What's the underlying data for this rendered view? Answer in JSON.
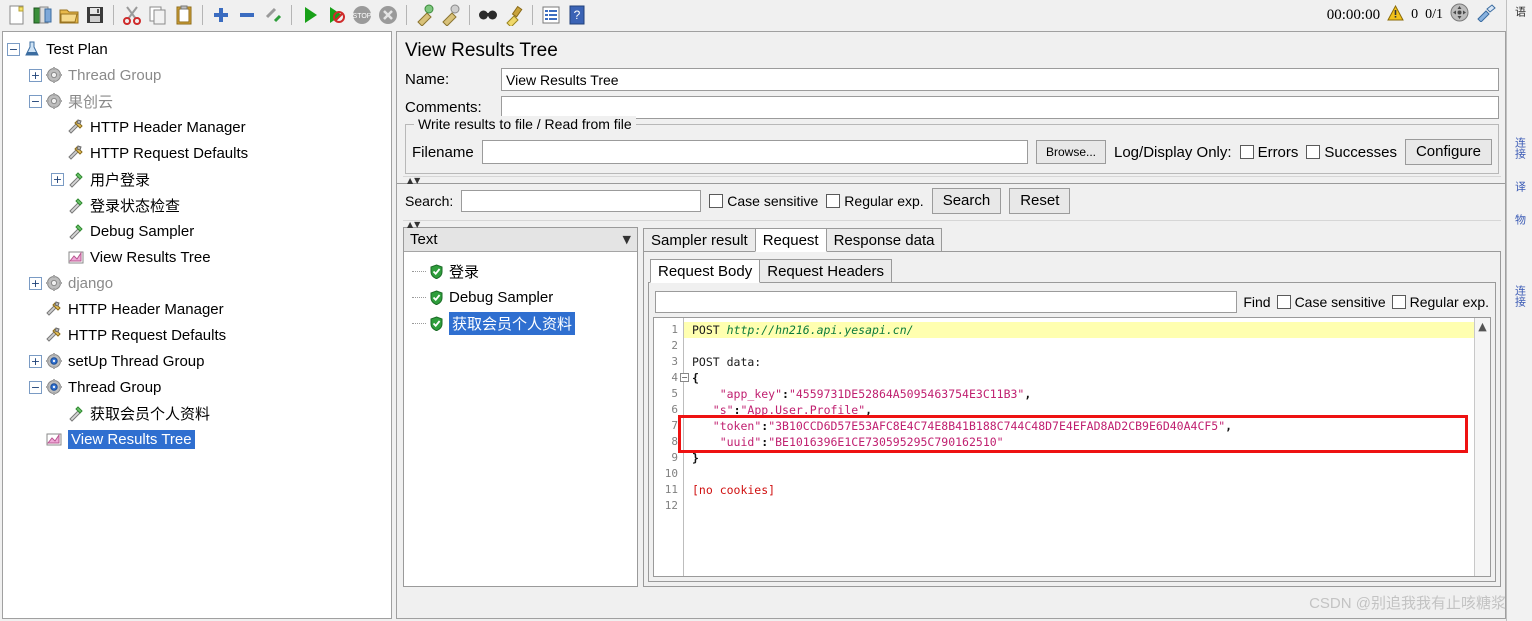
{
  "toolbar": {
    "buttons": [
      {
        "name": "new-icon",
        "glyph": "Ὄ4",
        "title": "New"
      },
      {
        "name": "templates-icon",
        "title": "Templates"
      },
      {
        "name": "open-icon",
        "title": "Open"
      },
      {
        "name": "save-icon",
        "title": "Save"
      },
      {
        "name": "cut-icon",
        "title": "Cut"
      },
      {
        "name": "copy-icon",
        "title": "Copy"
      },
      {
        "name": "paste-icon",
        "title": "Paste"
      },
      {
        "name": "expand-all-icon",
        "title": "Expand All"
      },
      {
        "name": "collapse-all-icon",
        "title": "Collapse All"
      },
      {
        "name": "toggle-icon",
        "title": "Toggle"
      },
      {
        "name": "start-icon",
        "title": "Start"
      },
      {
        "name": "start-no-pauses-icon",
        "title": "Start no pauses"
      },
      {
        "name": "stop-icon",
        "title": "Stop"
      },
      {
        "name": "shutdown-icon",
        "title": "Shutdown"
      },
      {
        "name": "clear-icon",
        "title": "Clear"
      },
      {
        "name": "clear-all-icon",
        "title": "Clear All"
      },
      {
        "name": "search-icon",
        "title": "Search"
      },
      {
        "name": "reset-search-icon",
        "title": "Reset Search"
      },
      {
        "name": "function-helper-icon",
        "title": "Function Helper Dialog"
      },
      {
        "name": "help-icon",
        "title": "Help"
      }
    ]
  },
  "status": {
    "elapsed": "00:00:00",
    "warning_count": "0",
    "threads": "0/1"
  },
  "tree": {
    "nodes": [
      {
        "label": "Test Plan",
        "indent": 0,
        "toggle": "minus",
        "icon": "test-plan-icon",
        "dim": false,
        "selected": false
      },
      {
        "label": "Thread Group",
        "indent": 1,
        "toggle": "plus",
        "icon": "thread-group-icon",
        "dim": true,
        "selected": false
      },
      {
        "label": "果创云",
        "indent": 1,
        "toggle": "minus",
        "icon": "thread-group-icon",
        "dim": true,
        "selected": false
      },
      {
        "label": "HTTP Header Manager",
        "indent": 2,
        "toggle": "none",
        "icon": "config-icon",
        "dim": false,
        "selected": false
      },
      {
        "label": "HTTP Request Defaults",
        "indent": 2,
        "toggle": "none",
        "icon": "config-icon",
        "dim": false,
        "selected": false
      },
      {
        "label": "用户登录",
        "indent": 2,
        "toggle": "plus",
        "icon": "sampler-icon",
        "dim": false,
        "selected": false
      },
      {
        "label": "登录状态检查",
        "indent": 2,
        "toggle": "none",
        "icon": "sampler-icon",
        "dim": false,
        "selected": false
      },
      {
        "label": "Debug Sampler",
        "indent": 2,
        "toggle": "none",
        "icon": "sampler-icon",
        "dim": false,
        "selected": false
      },
      {
        "label": "View Results Tree",
        "indent": 2,
        "toggle": "none",
        "icon": "listener-icon",
        "dim": false,
        "selected": false
      },
      {
        "label": "django",
        "indent": 1,
        "toggle": "plus",
        "icon": "thread-group-icon",
        "dim": true,
        "selected": false
      },
      {
        "label": "HTTP Header Manager",
        "indent": 1,
        "toggle": "none",
        "icon": "config-icon",
        "dim": false,
        "selected": false
      },
      {
        "label": "HTTP Request Defaults",
        "indent": 1,
        "toggle": "none",
        "icon": "config-icon",
        "dim": false,
        "selected": false
      },
      {
        "label": "setUp Thread Group",
        "indent": 1,
        "toggle": "plus",
        "icon": "setup-thread-group-icon",
        "dim": false,
        "selected": false
      },
      {
        "label": "Thread Group",
        "indent": 1,
        "toggle": "minus",
        "icon": "setup-thread-group-icon",
        "dim": false,
        "selected": false
      },
      {
        "label": "获取会员个人资料",
        "indent": 2,
        "toggle": "none",
        "icon": "sampler-icon",
        "dim": false,
        "selected": false
      },
      {
        "label": "View Results Tree",
        "indent": 1,
        "toggle": "none",
        "icon": "listener-icon",
        "dim": false,
        "selected": true
      }
    ]
  },
  "panel": {
    "title": "View Results Tree",
    "name_label": "Name:",
    "name_value": "View Results Tree",
    "comments_label": "Comments:",
    "comments_value": "",
    "comments_placeholder": "",
    "file_group_title": "Write results to file / Read from file",
    "filename_label": "Filename",
    "filename_value": "",
    "browse_label": "Browse...",
    "log_display_label": "Log/Display Only:",
    "errors_label": "Errors",
    "successes_label": "Successes",
    "configure_label": "Configure"
  },
  "search": {
    "label": "Search:",
    "value": "",
    "case_sensitive_label": "Case sensitive",
    "regular_exp_label": "Regular exp.",
    "search_button": "Search",
    "reset_button": "Reset"
  },
  "results": {
    "renderer_selected": "Text",
    "items": [
      {
        "label": "登录",
        "status": "success",
        "selected": false
      },
      {
        "label": "Debug Sampler",
        "status": "success",
        "selected": false
      },
      {
        "label": "获取会员个人资料",
        "status": "success",
        "selected": true
      }
    ]
  },
  "detail": {
    "tabs": [
      {
        "label": "Sampler result",
        "active": false
      },
      {
        "label": "Request",
        "active": true
      },
      {
        "label": "Response data",
        "active": false
      }
    ],
    "subtabs": [
      {
        "label": "Request Body",
        "active": true
      },
      {
        "label": "Request Headers",
        "active": false
      }
    ],
    "find": {
      "value": "",
      "find_label": "Find",
      "case_sensitive_label": "Case sensitive",
      "regular_exp_label": "Regular exp."
    },
    "code": {
      "line_numbers": [
        "1",
        "2",
        "3",
        "4",
        "5",
        "6",
        "7",
        "8",
        "9",
        "10",
        "11",
        "12"
      ],
      "lines": [
        {
          "n": 1,
          "highlight": true,
          "segments": [
            {
              "t": "POST ",
              "c": "kw-post"
            },
            {
              "t": "http://hn216.api.yesapi.cn/",
              "c": "url"
            }
          ]
        },
        {
          "n": 2,
          "highlight": false,
          "segments": []
        },
        {
          "n": 3,
          "highlight": false,
          "segments": [
            {
              "t": "POST data:",
              "c": "kw-post"
            }
          ]
        },
        {
          "n": 4,
          "highlight": false,
          "fold": true,
          "segments": [
            {
              "t": "{",
              "c": "punc"
            }
          ]
        },
        {
          "n": 5,
          "highlight": false,
          "segments": [
            {
              "t": "    ",
              "c": ""
            },
            {
              "t": "\"app_key\"",
              "c": "jkey"
            },
            {
              "t": ":",
              "c": "punc"
            },
            {
              "t": "\"4559731DE52864A5095463754E3C11B3\"",
              "c": "jstr"
            },
            {
              "t": ",",
              "c": "punc"
            }
          ]
        },
        {
          "n": 6,
          "highlight": false,
          "segments": [
            {
              "t": "   ",
              "c": ""
            },
            {
              "t": "\"s\"",
              "c": "jkey"
            },
            {
              "t": ":",
              "c": "punc"
            },
            {
              "t": "\"App.User.Profile\"",
              "c": "jstr"
            },
            {
              "t": ",",
              "c": "punc"
            }
          ]
        },
        {
          "n": 7,
          "highlight": false,
          "segments": [
            {
              "t": "   ",
              "c": ""
            },
            {
              "t": "\"token\"",
              "c": "jkey"
            },
            {
              "t": ":",
              "c": "punc"
            },
            {
              "t": "\"3B10CCD6D57E53AFC8E4C74E8B41B188C744C48D7E4EFAD8AD2CB9E6D40A4CF5\"",
              "c": "jstr"
            },
            {
              "t": ",",
              "c": "punc"
            }
          ]
        },
        {
          "n": 8,
          "highlight": false,
          "segments": [
            {
              "t": "    ",
              "c": ""
            },
            {
              "t": "\"uuid\"",
              "c": "jkey"
            },
            {
              "t": ":",
              "c": "punc"
            },
            {
              "t": "\"BE1016396E1CE730595295C790162510\"",
              "c": "jstr"
            }
          ]
        },
        {
          "n": 9,
          "highlight": false,
          "segments": [
            {
              "t": "}",
              "c": "punc"
            }
          ]
        },
        {
          "n": 10,
          "highlight": false,
          "segments": []
        },
        {
          "n": 11,
          "highlight": false,
          "segments": [
            {
              "t": "[no cookies]",
              "c": "cookie"
            }
          ]
        },
        {
          "n": 12,
          "highlight": false,
          "segments": []
        }
      ],
      "annotation_box_color": "#ee1111"
    }
  },
  "ide_strip": {
    "items": [
      "语",
      "连接",
      "译",
      "物",
      "连接"
    ]
  },
  "watermark": "CSDN @别追我我有止咳糖浆",
  "colors": {
    "accent": "#2f6fd0",
    "highlight": "#ffffb0",
    "annotation": "#ee1111",
    "url": "#0a7a3c",
    "json_string": "#c02070",
    "panel_bg": "#f0f0f0"
  }
}
